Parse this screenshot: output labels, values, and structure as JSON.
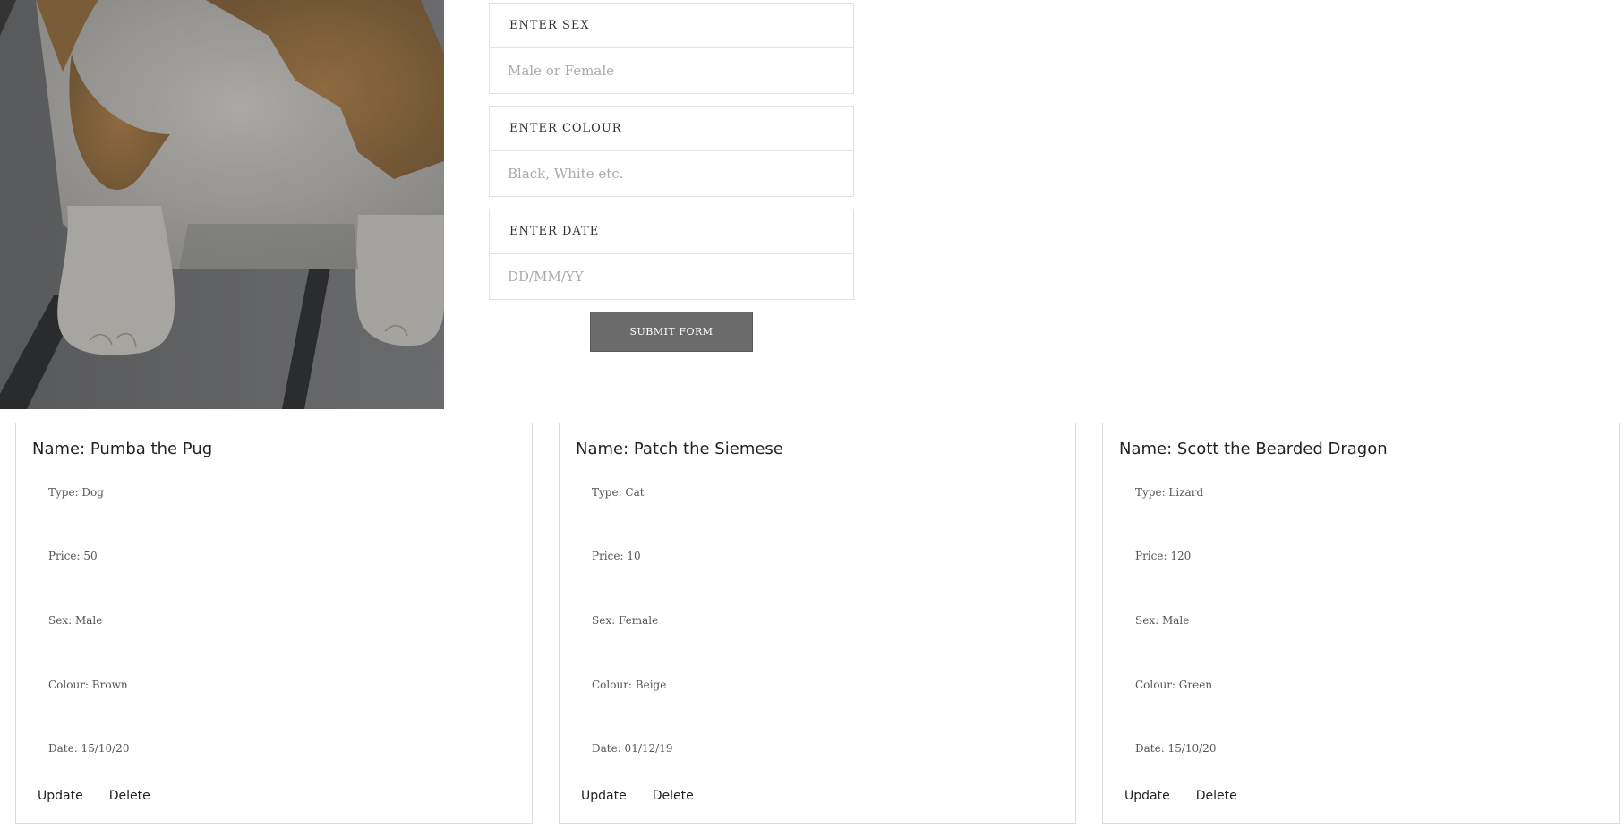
{
  "form": {
    "fields": [
      {
        "label": "ENTER SEX",
        "placeholder": "Male or Female",
        "value": ""
      },
      {
        "label": "ENTER COLOUR",
        "placeholder": "Black, White etc.",
        "value": ""
      },
      {
        "label": "ENTER DATE",
        "placeholder": "DD/MM/YY",
        "value": ""
      }
    ],
    "submit_label": "SUBMIT FORM"
  },
  "cards": [
    {
      "title": "Name: Pumba the Pug",
      "type": "Type: Dog",
      "price": "Price: 50",
      "sex": "Sex: Male",
      "colour": "Colour: Brown",
      "date": "Date: 15/10/20",
      "update_label": "Update",
      "delete_label": "Delete"
    },
    {
      "title": "Name: Patch the Siemese",
      "type": "Type: Cat",
      "price": "Price: 10",
      "sex": "Sex: Female",
      "colour": "Colour: Beige",
      "date": "Date: 01/12/19",
      "update_label": "Update",
      "delete_label": "Delete"
    },
    {
      "title": "Name: Scott the Bearded Dragon",
      "type": "Type: Lizard",
      "price": "Price: 120",
      "sex": "Sex: Male",
      "colour": "Colour: Green",
      "date": "Date: 15/10/20",
      "update_label": "Update",
      "delete_label": "Delete"
    }
  ],
  "colors": {
    "submit_bg": "#6b6b6b",
    "border": "#e2e2e2",
    "photo_dim": "#4c4d4f"
  }
}
